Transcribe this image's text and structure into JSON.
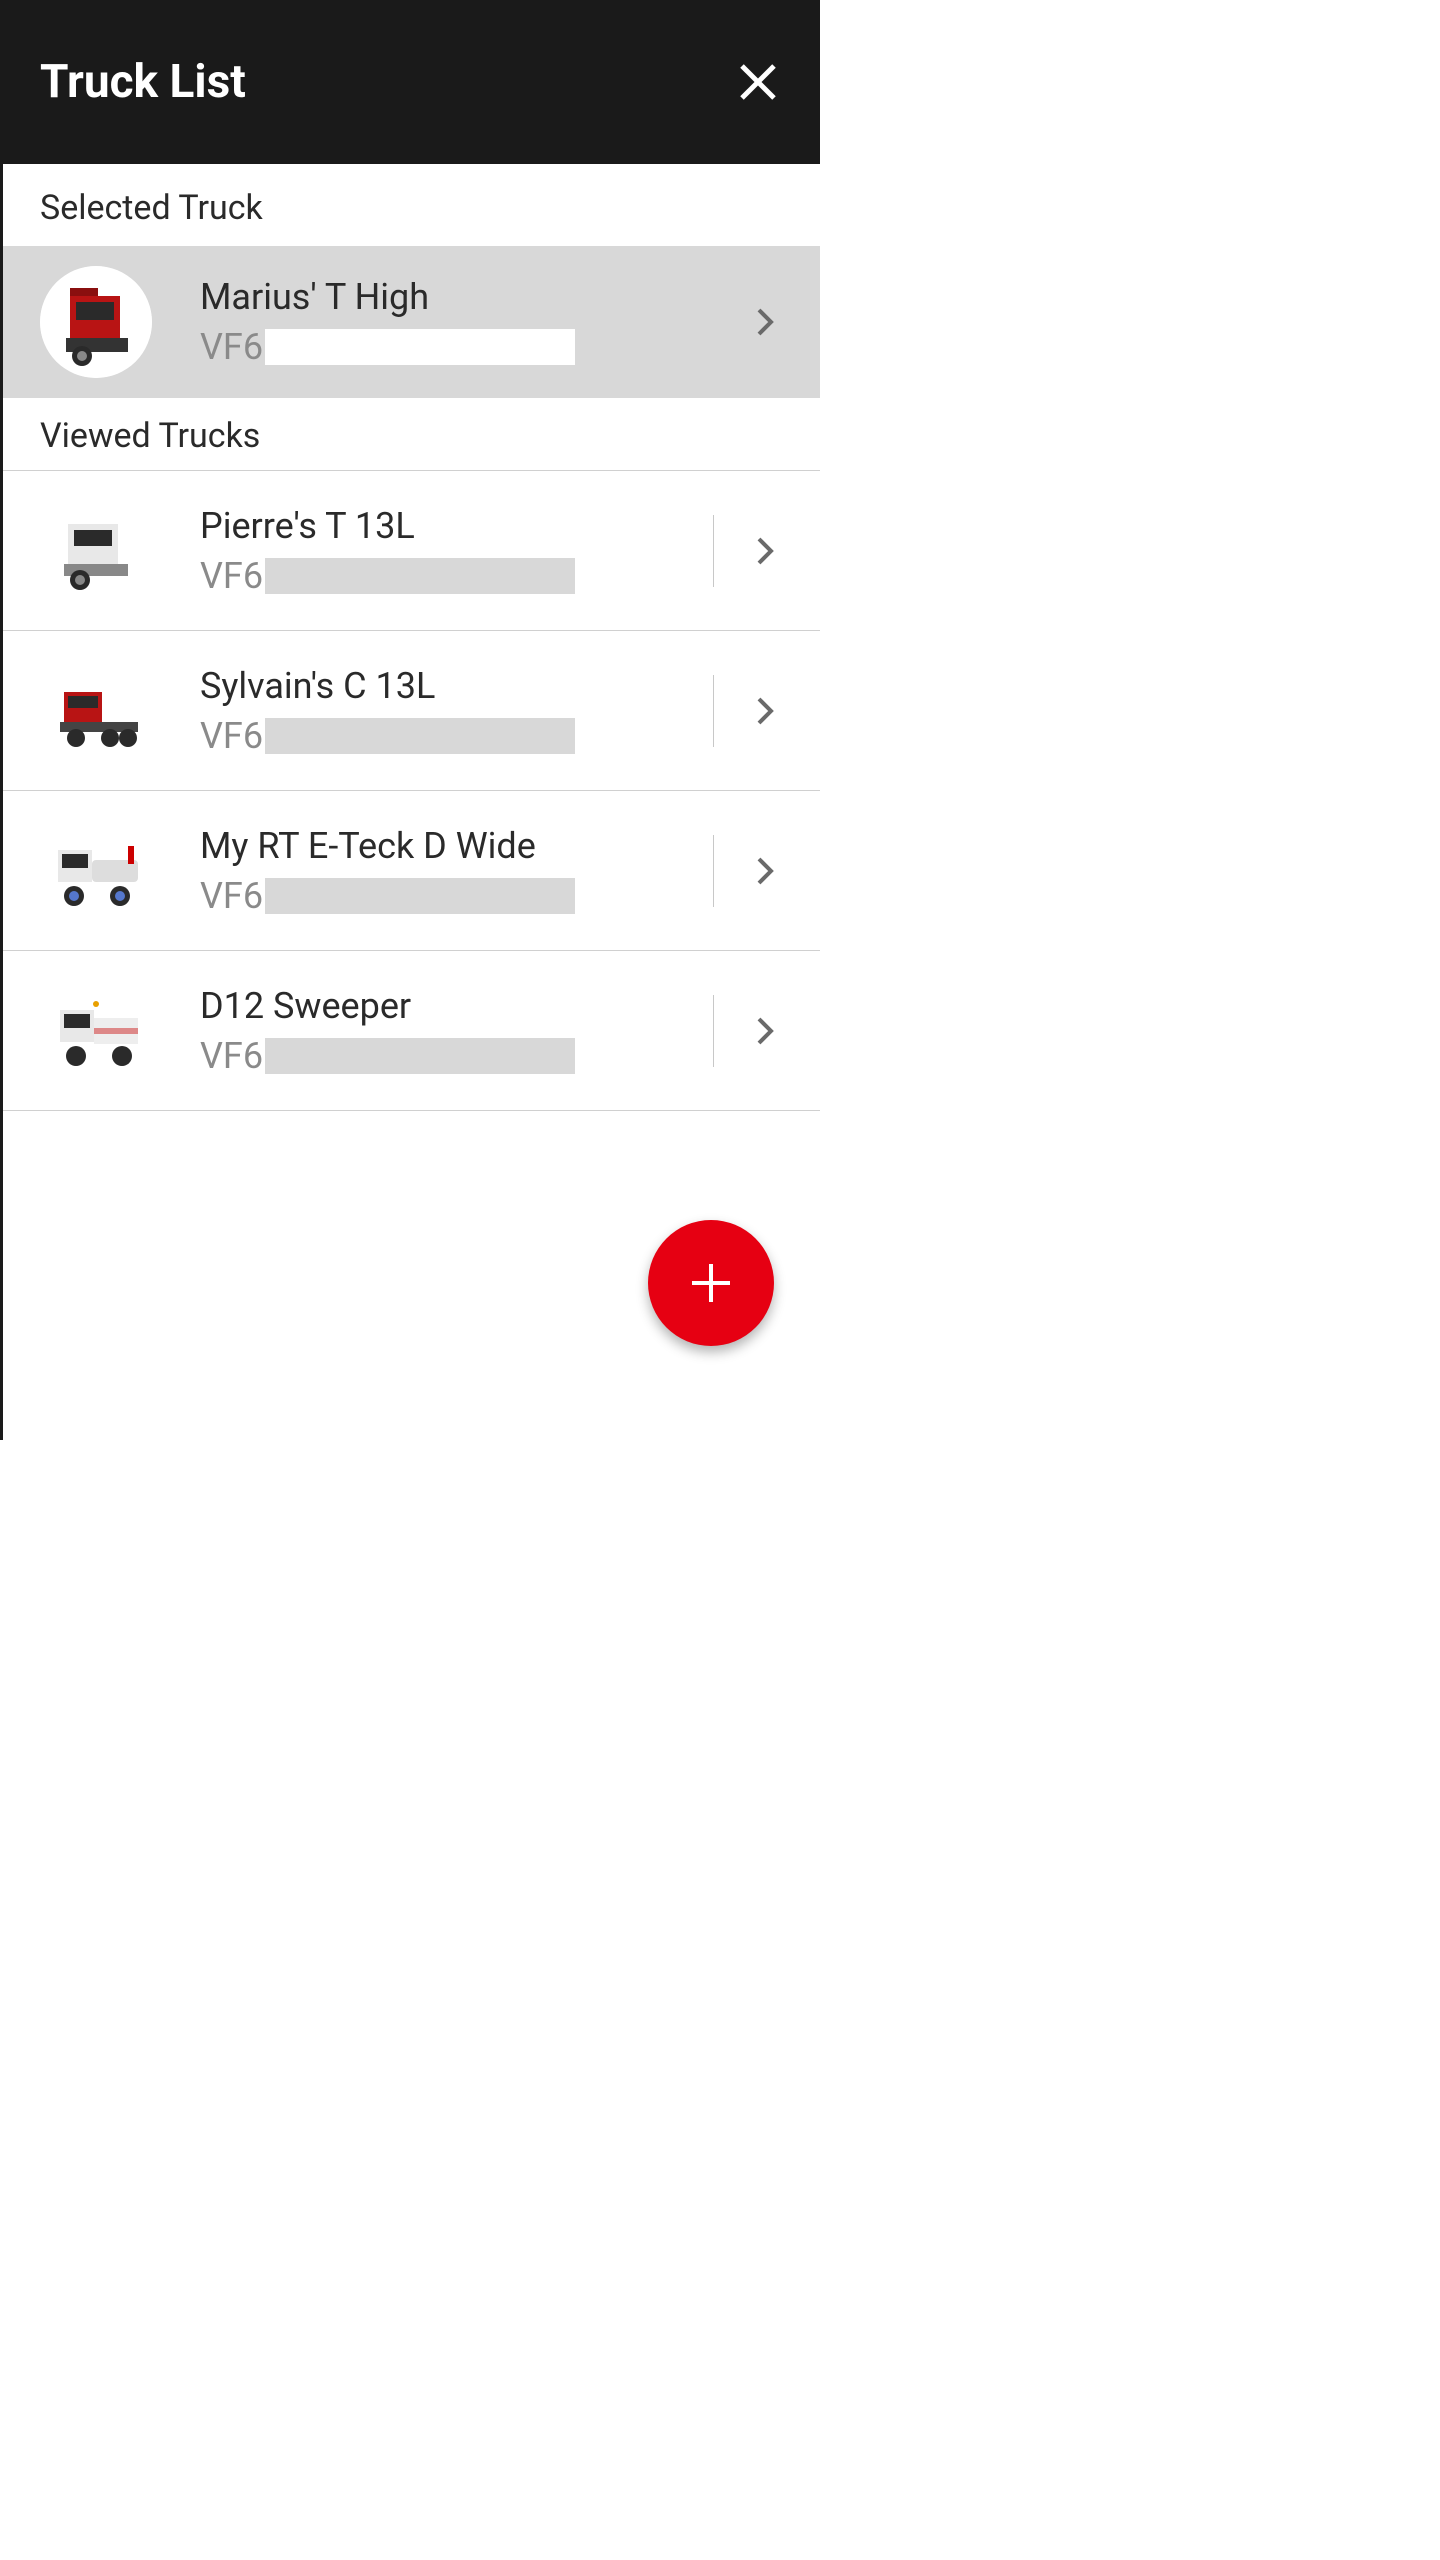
{
  "header": {
    "title": "Truck List"
  },
  "sections": {
    "selected_label": "Selected Truck",
    "viewed_label": "Viewed Trucks"
  },
  "selected": {
    "name": "Marius' T High",
    "vin_prefix": "VF6"
  },
  "viewed": [
    {
      "name": "Pierre's T 13L",
      "vin_prefix": "VF6",
      "thumb": "white-tractor"
    },
    {
      "name": "Sylvain's C 13L",
      "vin_prefix": "VF6",
      "thumb": "red-chassis"
    },
    {
      "name": "My RT E-Teck D Wide",
      "vin_prefix": "VF6",
      "thumb": "white-crane"
    },
    {
      "name": "D12 Sweeper",
      "vin_prefix": "VF6",
      "thumb": "white-sweeper"
    }
  ],
  "colors": {
    "accent": "#e60012",
    "header_bg": "#1a1a1a"
  }
}
